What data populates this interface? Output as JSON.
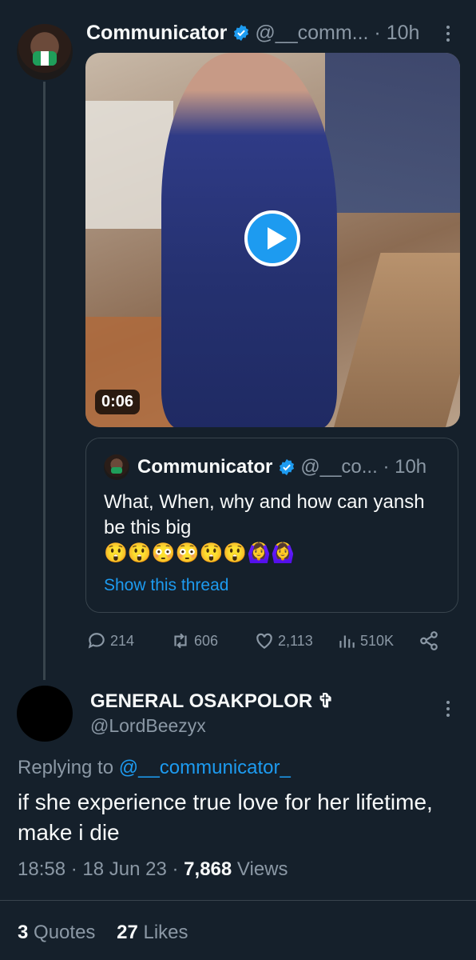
{
  "tweet": {
    "author_name": "Communicator",
    "author_handle": "@__comm...",
    "time": "10h",
    "video_duration": "0:06",
    "quote": {
      "author_name": "Communicator",
      "author_handle": "@__co...",
      "time": "10h",
      "text": "What, When, why and how can yansh be this big",
      "emojis": "😲😲😳😳😲😲🙆‍♀️🙆‍♀️",
      "show_thread": "Show this thread"
    },
    "actions": {
      "replies": "214",
      "retweets": "606",
      "likes": "2,113",
      "views": "510K"
    }
  },
  "reply": {
    "author_name": "GENERAL OSAKPOLOR ✞",
    "author_handle": "@LordBeezyx",
    "replying_prefix": "Replying to",
    "replying_to": "@__communicator_",
    "text": "if she experience true love for her lifetime, make i die",
    "time": "18:58",
    "date": "18 Jun 23",
    "views_count": "7,868",
    "views_label": "Views",
    "quotes_count": "3",
    "quotes_label": "Quotes",
    "likes_count": "27",
    "likes_label": "Likes"
  },
  "colors": {
    "background": "#15202b",
    "accent": "#1d9bf0",
    "muted": "#8b98a5",
    "border": "#38444d"
  }
}
